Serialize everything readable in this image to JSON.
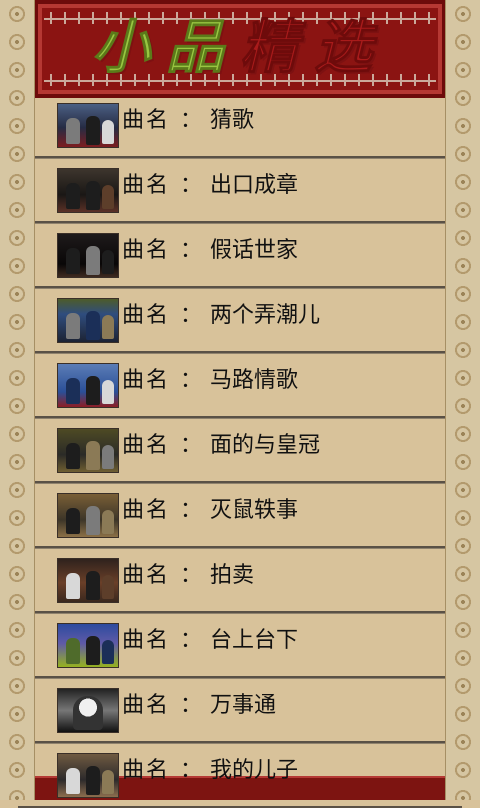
{
  "app": {
    "title": "小品精选"
  },
  "header": {
    "title_part_1": "小品",
    "title_part_2": "精选"
  },
  "list": {
    "label_prefix": "曲名",
    "colon": "：",
    "items": [
      {
        "title": "猜歌",
        "thumb_icon": "performance-thumbnail-icon"
      },
      {
        "title": "出口成章",
        "thumb_icon": "performance-thumbnail-icon"
      },
      {
        "title": "假话世家",
        "thumb_icon": "performance-thumbnail-icon"
      },
      {
        "title": "两个弄潮儿",
        "thumb_icon": "performance-thumbnail-icon"
      },
      {
        "title": "马路情歌",
        "thumb_icon": "performance-thumbnail-icon"
      },
      {
        "title": "面的与皇冠",
        "thumb_icon": "performance-thumbnail-icon"
      },
      {
        "title": "灭鼠轶事",
        "thumb_icon": "performance-thumbnail-icon"
      },
      {
        "title": "拍卖",
        "thumb_icon": "performance-thumbnail-icon"
      },
      {
        "title": "台上台下",
        "thumb_icon": "performance-thumbnail-icon"
      },
      {
        "title": "万事通",
        "thumb_icon": "performance-thumbnail-icon"
      },
      {
        "title": "我的儿子",
        "thumb_icon": "performance-thumbnail-icon"
      }
    ]
  },
  "colors": {
    "paper": "#d8c29a",
    "header_red": "#8b1412",
    "title_green": "#99c642",
    "title_red": "#a91b1b",
    "separator": "#5a5146",
    "text": "#111111"
  }
}
